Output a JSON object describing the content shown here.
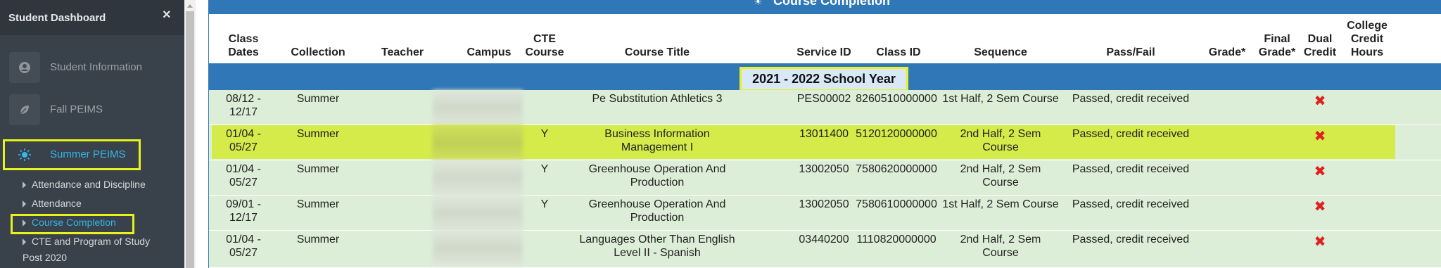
{
  "sidebar": {
    "title": "Student Dashboard",
    "close_glyph": "×",
    "items": [
      {
        "label": "Student Information",
        "icon": "user-circle-icon"
      },
      {
        "label": "Fall PEIMS",
        "icon": "leaf-icon"
      },
      {
        "label": "Summer PEIMS",
        "icon": "sun-icon",
        "active": true
      }
    ],
    "subitems": [
      {
        "label": "Attendance and Discipline"
      },
      {
        "label": "Attendance"
      },
      {
        "label": "Course Completion",
        "active": true
      },
      {
        "label": "CTE and Program of Study"
      },
      {
        "label": "Post 2020"
      }
    ]
  },
  "panel": {
    "title": "Course Completion",
    "columns": [
      "Class Dates",
      "Collection",
      "Teacher",
      "Campus",
      "CTE Course",
      "Course Title",
      "Service ID",
      "Class ID",
      "Sequence",
      "Pass/Fail",
      "Grade*",
      "Final Grade*",
      "Dual Credit",
      "College Credit Hours"
    ],
    "school_year": "2021 - 2022 School Year",
    "rows": [
      {
        "dates": "08/12 - 12/17",
        "collection": "Summer",
        "teacher": "",
        "cte": "",
        "title": "Pe Substitution Athletics 3",
        "service_id": "PES00002",
        "class_id": "8260510000000",
        "sequence": "1st Half, 2 Sem Course",
        "pass_fail": "Passed, credit received",
        "grade": "",
        "final_grade": "",
        "dual": "✖",
        "college_hours": ""
      },
      {
        "dates": "01/04 - 05/27",
        "collection": "Summer",
        "teacher": "",
        "cte": "Y",
        "title": "Business Information Management I",
        "service_id": "13011400",
        "class_id": "5120120000000",
        "sequence": "2nd Half, 2 Sem Course",
        "pass_fail": "Passed, credit received",
        "grade": "",
        "final_grade": "",
        "dual": "✖",
        "college_hours": "",
        "highlighted": true
      },
      {
        "dates": "01/04 - 05/27",
        "collection": "Summer",
        "teacher": "",
        "cte": "Y",
        "title": "Greenhouse Operation And Production",
        "service_id": "13002050",
        "class_id": "7580620000000",
        "sequence": "2nd Half, 2 Sem Course",
        "pass_fail": "Passed, credit received",
        "grade": "",
        "final_grade": "",
        "dual": "✖",
        "college_hours": ""
      },
      {
        "dates": "09/01 - 12/17",
        "collection": "Summer",
        "teacher": "",
        "cte": "Y",
        "title": "Greenhouse Operation And Production",
        "service_id": "13002050",
        "class_id": "7580610000000",
        "sequence": "1st Half, 2 Sem Course",
        "pass_fail": "Passed, credit received",
        "grade": "",
        "final_grade": "",
        "dual": "✖",
        "college_hours": ""
      },
      {
        "dates": "01/04 - 05/27",
        "collection": "Summer",
        "teacher": "",
        "cte": "",
        "title": "Languages Other Than English Level II - Spanish",
        "service_id": "03440200",
        "class_id": "1110820000000",
        "sequence": "2nd Half, 2 Sem Course",
        "pass_fail": "Passed, credit received",
        "grade": "",
        "final_grade": "",
        "dual": "✖",
        "college_hours": ""
      }
    ]
  },
  "colors": {
    "accent": "#3077b7",
    "highlight": "#e8f21b",
    "row_bg": "#ddeed8",
    "active_link": "#35b7e8",
    "error": "#e02020"
  }
}
